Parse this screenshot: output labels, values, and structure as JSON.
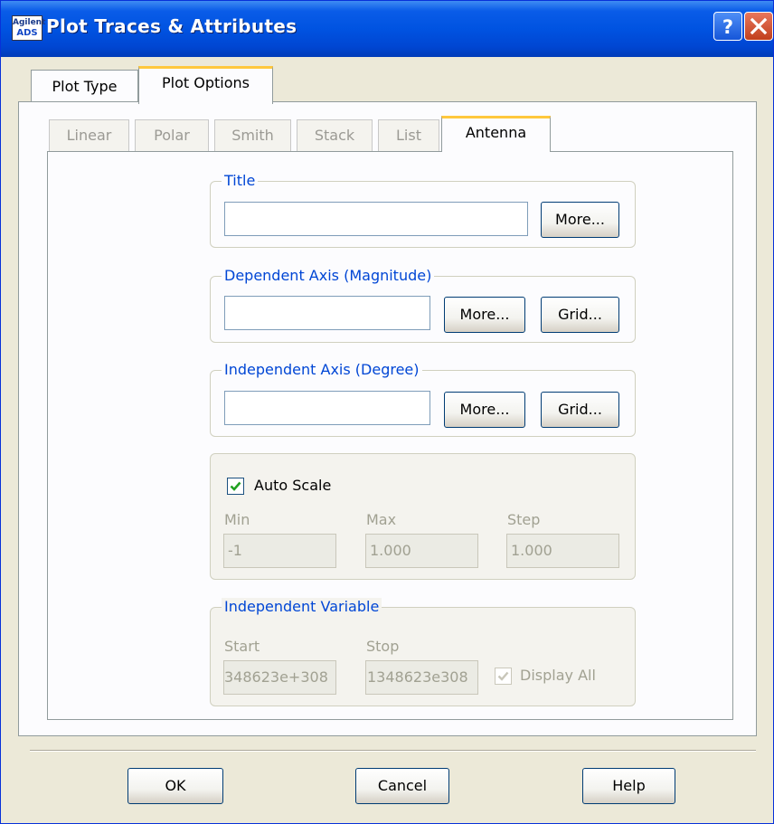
{
  "window": {
    "title": "Plot Traces & Attributes",
    "icon_top": "Agilent",
    "icon_bottom": "ADS"
  },
  "tabs": [
    {
      "label": "Plot Type",
      "active": false
    },
    {
      "label": "Plot Options",
      "active": true
    }
  ],
  "subtabs": [
    {
      "label": "Linear",
      "active": false
    },
    {
      "label": "Polar",
      "active": false
    },
    {
      "label": "Smith",
      "active": false
    },
    {
      "label": "Stack",
      "active": false
    },
    {
      "label": "List",
      "active": false
    },
    {
      "label": "Antenna",
      "active": true
    }
  ],
  "title_group": {
    "label": "Title",
    "value": "",
    "more_label": "More..."
  },
  "dependent_axis": {
    "label": "Dependent Axis (Magnitude)",
    "value": "",
    "more_label": "More...",
    "grid_label": "Grid..."
  },
  "independent_axis": {
    "label": "Independent Axis (Degree)",
    "value": "",
    "more_label": "More...",
    "grid_label": "Grid..."
  },
  "scale": {
    "auto_scale_label": "Auto Scale",
    "auto_scale_checked": true,
    "min_label": "Min",
    "min_value": "-1",
    "max_label": "Max",
    "max_value": "1.000",
    "step_label": "Step",
    "step_value": "1.000"
  },
  "independent_variable": {
    "label": "Independent Variable",
    "start_label": "Start",
    "start_value": "348623e+308",
    "stop_label": "Stop",
    "stop_value": "1348623e308",
    "display_all_label": "Display All",
    "display_all_checked": true
  },
  "footer": {
    "ok_label": "OK",
    "cancel_label": "Cancel",
    "help_label": "Help"
  },
  "colors": {
    "titlebar": "#0053e1",
    "group_label": "#0046d5",
    "tab_highlight": "#ffc83c",
    "dialog_bg": "#ece9d8"
  }
}
